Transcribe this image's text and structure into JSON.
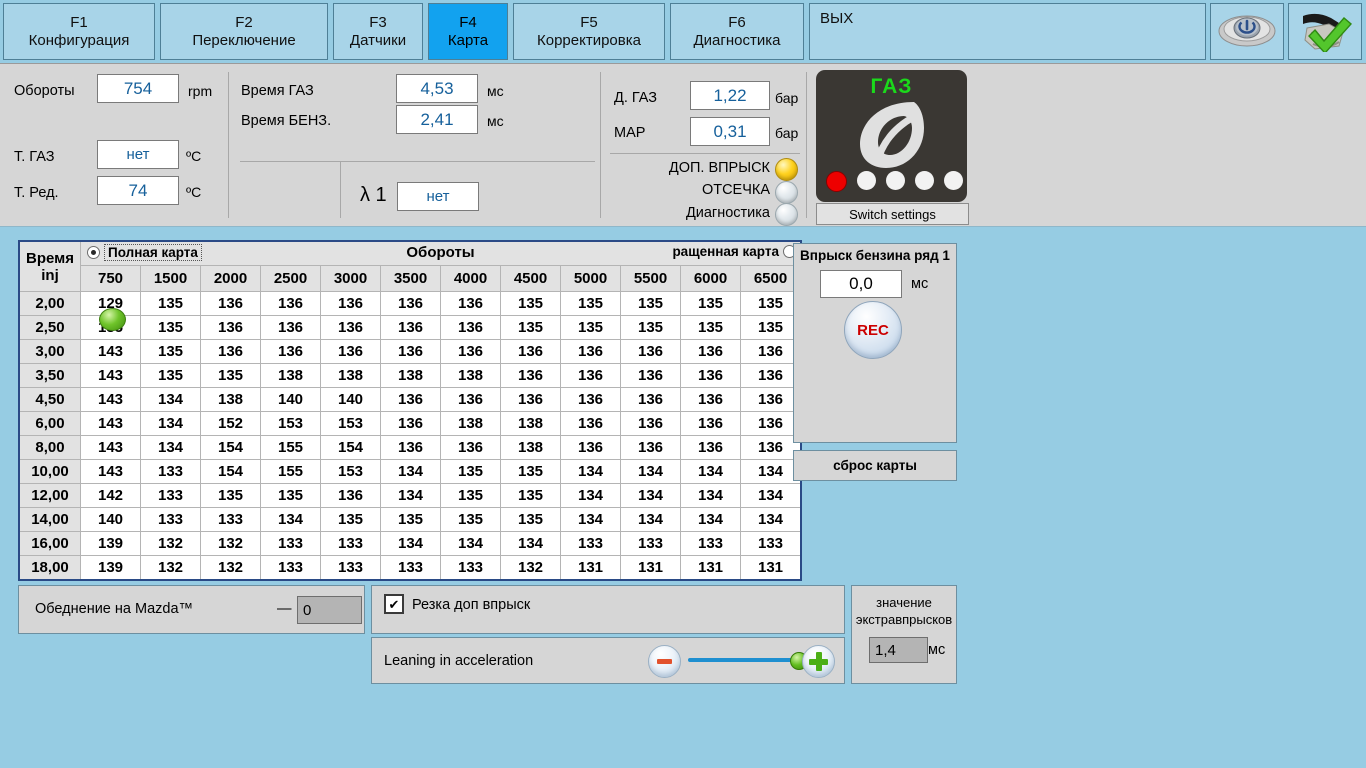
{
  "toolbar": {
    "tabs": [
      {
        "fkey": "F1",
        "label": "Конфигурация"
      },
      {
        "fkey": "F2",
        "label": "Переключение"
      },
      {
        "fkey": "F3",
        "label": "Датчики"
      },
      {
        "fkey": "F4",
        "label": "Карта"
      },
      {
        "fkey": "F5",
        "label": "Корректировка"
      },
      {
        "fkey": "F6",
        "label": "Диагностика"
      }
    ],
    "exit_label": "ВЫХ",
    "active_tab": "F4",
    "icons": [
      "power-icon",
      "connector-ok-icon"
    ]
  },
  "status": {
    "rpm_label": "Обороты",
    "rpm_value": "754",
    "rpm_unit": "rpm",
    "tgas_label": "Т. ГАЗ",
    "tgas_value": "нет",
    "tgas_unit": "ºC",
    "tred_label": "Т. Ред.",
    "tred_value": "74",
    "tred_unit": "ºC",
    "time_gas_label": "Время ГАЗ",
    "time_gas_value": "4,53",
    "time_gas_unit": "мс",
    "time_ben_label": "Время БЕНЗ.",
    "time_ben_value": "2,41",
    "time_ben_unit": "мс",
    "lambda_label": "λ 1",
    "lambda_value": "нет",
    "dgas_label": "Д. ГАЗ",
    "dgas_value": "1,22",
    "dgas_unit": "бар",
    "map_label": "МАР",
    "map_value": "0,31",
    "map_unit": "бар",
    "lamps": [
      {
        "label": "ДОП. ВПРЫСК",
        "state": "on"
      },
      {
        "label": "ОТСЕЧКА",
        "state": "off"
      },
      {
        "label": "Диагностика",
        "state": "off"
      }
    ],
    "gas_panel": {
      "title": "ГАЗ",
      "level_dots": [
        "red",
        "white",
        "white",
        "white",
        "white"
      ],
      "switch_button": "Switch settings"
    }
  },
  "map": {
    "radio_full_label": "Полная карта",
    "radio_full_selected": true,
    "radio_short_label": "ращенная карта",
    "radio_short_selected": false,
    "rpm_header": "Обороты",
    "time_header_line1": "Время",
    "time_header_line2": "inj",
    "columns": [
      "750",
      "1500",
      "2000",
      "2500",
      "3000",
      "3500",
      "4000",
      "4500",
      "5000",
      "5500",
      "6000",
      "6500"
    ],
    "rows": [
      {
        "label": "2,00",
        "values": [
          "129",
          "135",
          "136",
          "136",
          "136",
          "136",
          "136",
          "135",
          "135",
          "135",
          "135",
          "135"
        ]
      },
      {
        "label": "2,50",
        "values": [
          "135",
          "135",
          "136",
          "136",
          "136",
          "136",
          "136",
          "135",
          "135",
          "135",
          "135",
          "135"
        ]
      },
      {
        "label": "3,00",
        "values": [
          "143",
          "135",
          "136",
          "136",
          "136",
          "136",
          "136",
          "136",
          "136",
          "136",
          "136",
          "136"
        ]
      },
      {
        "label": "3,50",
        "values": [
          "143",
          "135",
          "135",
          "138",
          "138",
          "138",
          "138",
          "136",
          "136",
          "136",
          "136",
          "136"
        ]
      },
      {
        "label": "4,50",
        "values": [
          "143",
          "134",
          "138",
          "140",
          "140",
          "136",
          "136",
          "136",
          "136",
          "136",
          "136",
          "136"
        ]
      },
      {
        "label": "6,00",
        "values": [
          "143",
          "134",
          "152",
          "153",
          "153",
          "136",
          "138",
          "138",
          "136",
          "136",
          "136",
          "136"
        ]
      },
      {
        "label": "8,00",
        "values": [
          "143",
          "134",
          "154",
          "155",
          "154",
          "136",
          "136",
          "138",
          "136",
          "136",
          "136",
          "136"
        ]
      },
      {
        "label": "10,00",
        "values": [
          "143",
          "133",
          "154",
          "155",
          "153",
          "134",
          "135",
          "135",
          "134",
          "134",
          "134",
          "134"
        ]
      },
      {
        "label": "12,00",
        "values": [
          "142",
          "133",
          "135",
          "135",
          "136",
          "134",
          "135",
          "135",
          "134",
          "134",
          "134",
          "134"
        ]
      },
      {
        "label": "14,00",
        "values": [
          "140",
          "133",
          "133",
          "134",
          "135",
          "135",
          "135",
          "135",
          "134",
          "134",
          "134",
          "134"
        ]
      },
      {
        "label": "16,00",
        "values": [
          "139",
          "132",
          "132",
          "133",
          "133",
          "134",
          "134",
          "134",
          "133",
          "133",
          "133",
          "133"
        ]
      },
      {
        "label": "18,00",
        "values": [
          "139",
          "132",
          "132",
          "133",
          "133",
          "133",
          "133",
          "132",
          "131",
          "131",
          "131",
          "131"
        ]
      }
    ],
    "cursor": {
      "row_index": 1,
      "col_index": 0
    }
  },
  "right_panel": {
    "title": "Впрыск бензина ряд 1",
    "value": "0,0",
    "unit": "мс",
    "rec_label": "REC",
    "reset_label": "сброс карты"
  },
  "bottom": {
    "mazda_label": "Обеднение на Mazda™",
    "mazda_dash": "—",
    "mazda_value": "0",
    "cut_checkbox_label": "Резка доп впрыск",
    "cut_checkbox_checked": true,
    "cut_checkbox_glyph": "✔",
    "leaning_label": "Leaning in acceleration",
    "leaning_slider_percent": 92,
    "extra_title_line1": "значение",
    "extra_title_line2": "экстравпрысков",
    "extra_value": "1,4",
    "extra_unit": "мс"
  },
  "colors": {
    "background": "#96cce3",
    "panel": "#d6d6d6",
    "active_tab": "#12a2ef",
    "tab": "#a8d4e8",
    "field_text": "#16609b",
    "gas_green": "#1bd91b",
    "rec_red": "#cc0000"
  }
}
